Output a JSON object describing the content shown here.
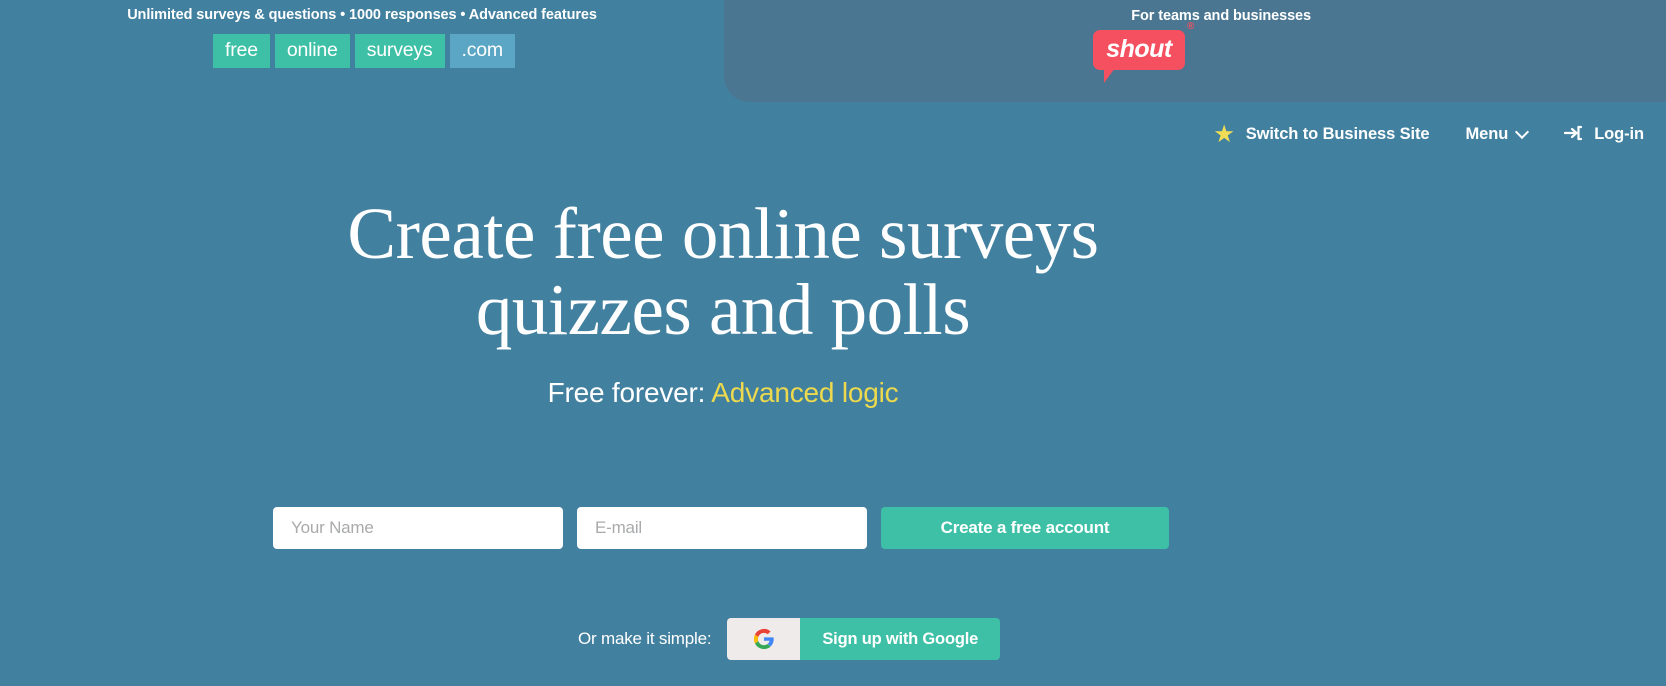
{
  "promo": {
    "tagline": "Unlimited surveys & questions • 1000 responses • Advanced features",
    "tags": [
      {
        "label": "free",
        "style": "teal"
      },
      {
        "label": "online",
        "style": "teal"
      },
      {
        "label": "surveys",
        "style": "teal"
      },
      {
        "label": ".com",
        "style": "blue"
      }
    ]
  },
  "business_banner": {
    "caption": "For teams and businesses",
    "logo_text": "shout",
    "registered_mark": "®"
  },
  "nav": {
    "switch_label": "Switch to Business Site",
    "menu_label": "Menu",
    "login_label": "Log-in",
    "star_icon": "★",
    "login_icon": "→]"
  },
  "hero": {
    "headline_line1": "Create free online surveys",
    "headline_line2": "quizzes and polls",
    "sub_prefix": "Free forever: ",
    "sub_accent": "Advanced logic"
  },
  "signup": {
    "name_placeholder": "Your Name",
    "name_value": "",
    "email_placeholder": "E-mail",
    "email_value": "",
    "cta_label": "Create a free account"
  },
  "google": {
    "prompt": "Or make it simple:",
    "button_label": "Sign up with Google",
    "icon_name": "google-g-icon"
  },
  "colors": {
    "background": "#42809f",
    "banner": "#4a7691",
    "teal": "#3dc0a5",
    "tag_blue": "#5ba6c4",
    "logo_pink": "#f4505f",
    "accent_yellow": "#ecd94e",
    "star_yellow": "#f0dd55"
  }
}
